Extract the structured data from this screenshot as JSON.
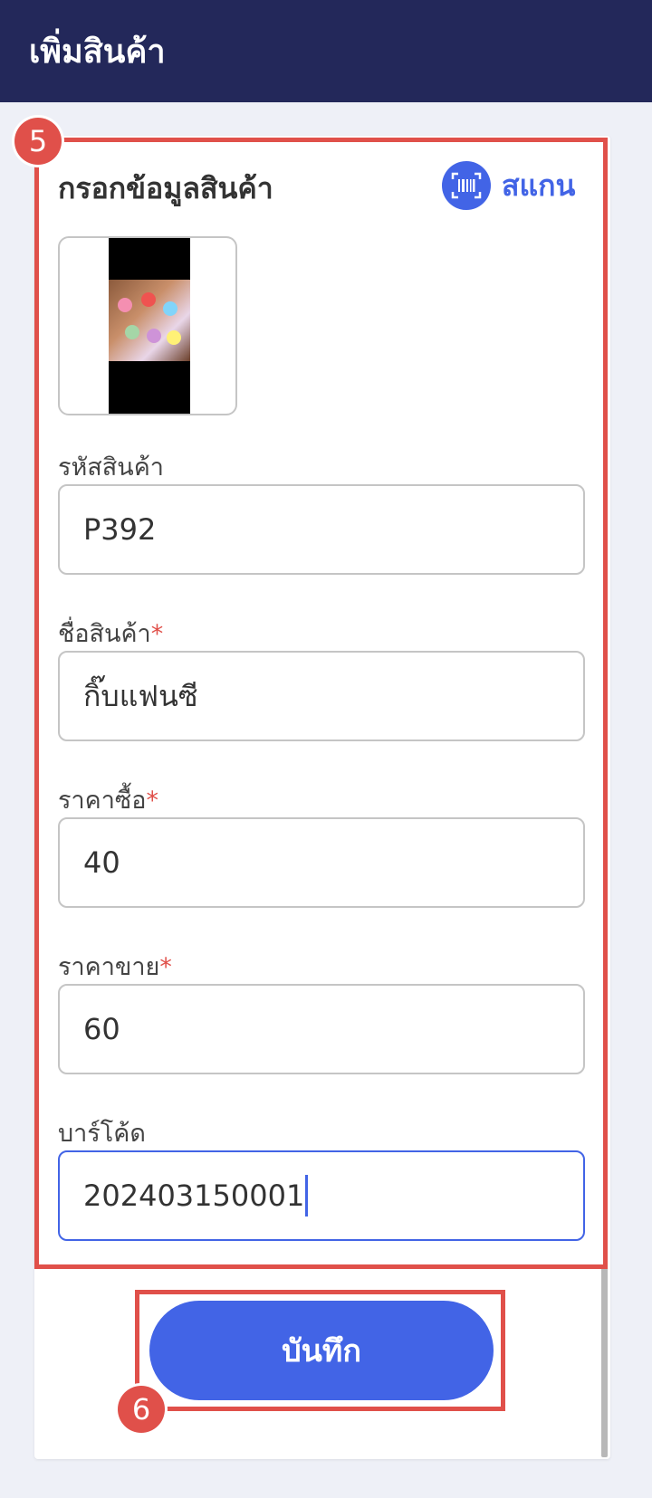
{
  "header": {
    "title": "เพิ่มสินค้า"
  },
  "form": {
    "title": "กรอกข้อมูลสินค้า",
    "scan_label": "สแกน",
    "fields": [
      {
        "label": "รหัสสินค้า",
        "required": false,
        "value": "P392"
      },
      {
        "label": "ชื่อสินค้า",
        "required": true,
        "value": "กิ๊บแฟนซี"
      },
      {
        "label": "ราคาซื้อ",
        "required": true,
        "value": "40"
      },
      {
        "label": "ราคาขาย",
        "required": true,
        "value": "60"
      },
      {
        "label": "บาร์โค้ด",
        "required": false,
        "value": "202403150001"
      }
    ],
    "required_mark": "*"
  },
  "save_button": {
    "label": "บันทึก"
  },
  "callouts": [
    "5",
    "6"
  ],
  "icons": {
    "scan": "barcode-scan-icon",
    "image": "product-image"
  },
  "colors": {
    "header_bg": "#23285a",
    "accent": "#4264e6",
    "callout": "#e0504a",
    "page_bg": "#eef0f7"
  }
}
